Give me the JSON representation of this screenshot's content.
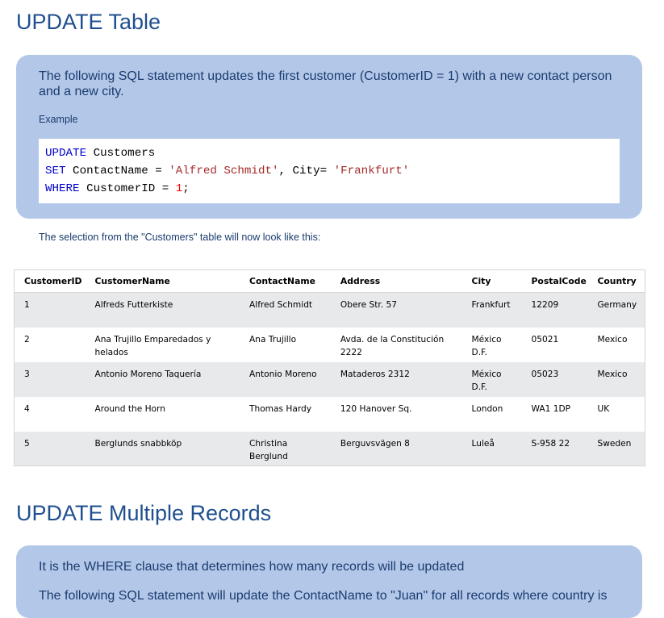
{
  "section1": {
    "title": "UPDATE Table",
    "lead": "The following SQL statement updates the first customer (CustomerID = 1) with a new contact person and a new city.",
    "example_label": "Example",
    "code": {
      "line1_kw": "UPDATE",
      "line1_rest": " Customers",
      "line2_kw": "SET",
      "line2_a": " ContactName = ",
      "line2_str1": "'Alfred Schmidt'",
      "line2_b": ", City= ",
      "line2_str2": "'Frankfurt'",
      "line3_kw": "WHERE",
      "line3_a": " CustomerID = ",
      "line3_num": "1",
      "line3_end": ";"
    },
    "note": "The selection from the \"Customers\" table will now look like this:"
  },
  "table": {
    "headers": [
      "CustomerID",
      "CustomerName",
      "ContactName",
      "Address",
      "City",
      "PostalCode",
      "Country"
    ],
    "rows": [
      [
        "1",
        "Alfreds Futterkiste",
        "Alfred Schmidt",
        "Obere Str. 57",
        "Frankfurt",
        "12209",
        "Germany"
      ],
      [
        "2",
        "Ana Trujillo Emparedados y helados",
        "Ana Trujillo",
        "Avda. de la Constitución 2222",
        "México D.F.",
        "05021",
        "Mexico"
      ],
      [
        "3",
        "Antonio Moreno Taquería",
        "Antonio Moreno",
        "Mataderos 2312",
        "México D.F.",
        "05023",
        "Mexico"
      ],
      [
        "4",
        "Around the Horn",
        "Thomas Hardy",
        "120 Hanover Sq.",
        "London",
        "WA1 1DP",
        "UK"
      ],
      [
        "5",
        "Berglunds snabbköp",
        "Christina Berglund",
        "Berguvsvägen 8",
        "Luleå",
        "S-958 22",
        "Sweden"
      ]
    ]
  },
  "section2": {
    "title": "UPDATE Multiple Records",
    "lead": "It is the WHERE clause that determines how many records will be updated",
    "lead2": "The following SQL statement will update the ContactName to \"Juan\" for all records where country is"
  }
}
